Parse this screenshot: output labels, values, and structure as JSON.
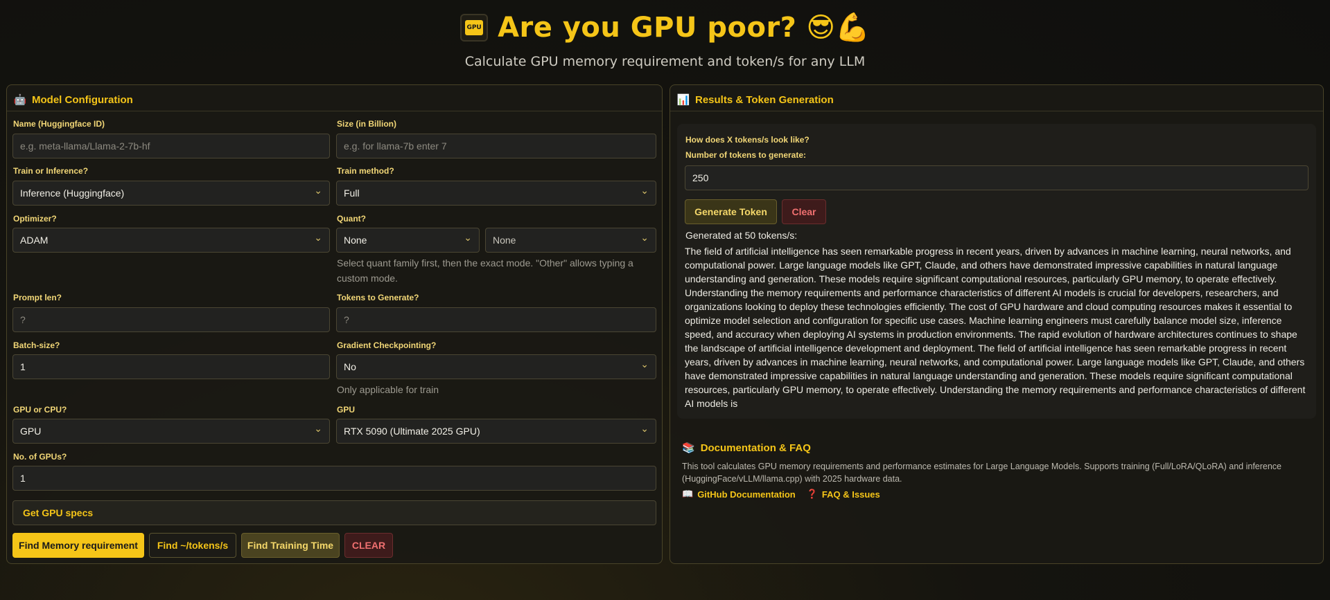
{
  "header": {
    "title": "Are you GPU poor?",
    "emoji": "😎💪",
    "chip_label": "GPU",
    "subtitle": "Calculate GPU memory requirement and token/s for any LLM"
  },
  "config": {
    "title": "Model Configuration",
    "icon": "robot-icon",
    "name_label": "Name (Huggingface ID)",
    "name_placeholder": "e.g. meta-llama/Llama-2-7b-hf",
    "size_label": "Size (in Billion)",
    "size_placeholder": "e.g. for llama-7b enter 7",
    "train_inf_label": "Train or Inference?",
    "train_inf_value": "Inference (Huggingface)",
    "train_method_label": "Train method?",
    "train_method_value": "Full",
    "optimizer_label": "Optimizer?",
    "optimizer_value": "ADAM",
    "quant_label": "Quant?",
    "quant_family_value": "None",
    "quant_mode_value": "None",
    "quant_hint": "Select quant family first, then the exact mode. \"Other\" allows typing a custom mode.",
    "prompt_len_label": "Prompt len?",
    "prompt_len_placeholder": "?",
    "tokens_gen_label": "Tokens to Generate?",
    "tokens_gen_placeholder": "?",
    "batch_label": "Batch-size?",
    "batch_value": "1",
    "grad_ckpt_label": "Gradient Checkpointing?",
    "grad_ckpt_value": "No",
    "grad_ckpt_hint": "Only applicable for train",
    "gpu_cpu_label": "GPU or CPU?",
    "gpu_cpu_value": "GPU",
    "gpu_label": "GPU",
    "gpu_value": "RTX 5090 (Ultimate 2025 GPU)",
    "num_gpus_label": "No. of GPUs?",
    "num_gpus_value": "1",
    "gpu_specs_label": "Get GPU specs",
    "btn_memory": "Find Memory requirement",
    "btn_tokens": "Find ~/tokens/s",
    "btn_training": "Find Training Time",
    "btn_clear": "CLEAR"
  },
  "results": {
    "title": "Results & Token Generation",
    "icon": "bar-chart-icon",
    "question": "How does X tokens/s look like?",
    "num_tokens_label": "Number of tokens to generate:",
    "num_tokens_value": "250",
    "btn_generate": "Generate Token",
    "btn_clear": "Clear",
    "generated_at": "Generated at 50 tokens/s:",
    "generated_text": "The field of artificial intelligence has seen remarkable progress in recent years, driven by advances in machine learning, neural networks, and computational power. Large language models like GPT, Claude, and others have demonstrated impressive capabilities in natural language understanding and generation. These models require significant computational resources, particularly GPU memory, to operate effectively. Understanding the memory requirements and performance characteristics of different AI models is crucial for developers, researchers, and organizations looking to deploy these technologies efficiently. The cost of GPU hardware and cloud computing resources makes it essential to optimize model selection and configuration for specific use cases. Machine learning engineers must carefully balance model size, inference speed, and accuracy when deploying AI systems in production environments. The rapid evolution of hardware architectures continues to shape the landscape of artificial intelligence development and deployment. The field of artificial intelligence has seen remarkable progress in recent years, driven by advances in machine learning, neural networks, and computational power. Large language models like GPT, Claude, and others have demonstrated impressive capabilities in natural language understanding and generation. These models require significant computational resources, particularly GPU memory, to operate effectively. Understanding the memory requirements and performance characteristics of different AI models is"
  },
  "docs": {
    "title": "Documentation & FAQ",
    "icon": "books-icon",
    "text": "This tool calculates GPU memory requirements and performance estimates for Large Language Models. Supports training (Full/LoRA/QLoRA) and inference (HuggingFace/vLLM/llama.cpp) with 2025 hardware data.",
    "link_github": "GitHub Documentation",
    "link_faq": "FAQ & Issues"
  },
  "colors": {
    "accent": "#f5c518",
    "danger": "#f07070",
    "background": "#15140f"
  }
}
